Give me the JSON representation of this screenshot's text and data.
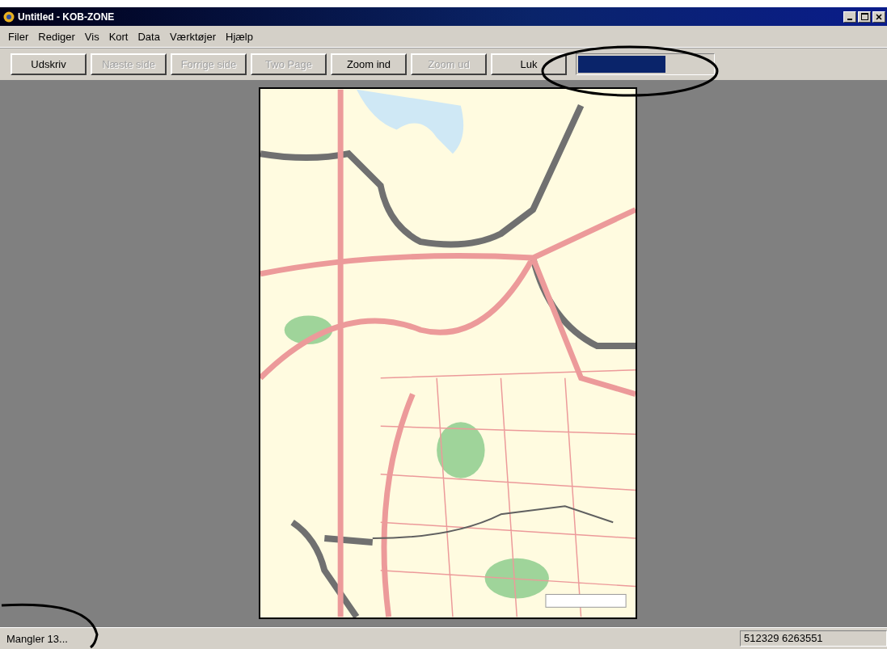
{
  "window": {
    "title": "Untitled - KOB-ZONE"
  },
  "menu": [
    "Filer",
    "Rediger",
    "Vis",
    "Kort",
    "Data",
    "Værktøjer",
    "Hjælp"
  ],
  "toolbar": [
    {
      "label": "Udskriv",
      "disabled": false
    },
    {
      "label": "Næste side",
      "disabled": true
    },
    {
      "label": "Forrige side",
      "disabled": true
    },
    {
      "label": "Two Page",
      "disabled": true
    },
    {
      "label": "Zoom ind",
      "disabled": false
    },
    {
      "label": "Zoom ud",
      "disabled": true
    },
    {
      "label": "Luk",
      "disabled": false
    }
  ],
  "progress": {
    "level": 0.65
  },
  "status_bar": {
    "message": "Mangler 13...",
    "coordinates": "512329 6263551"
  }
}
